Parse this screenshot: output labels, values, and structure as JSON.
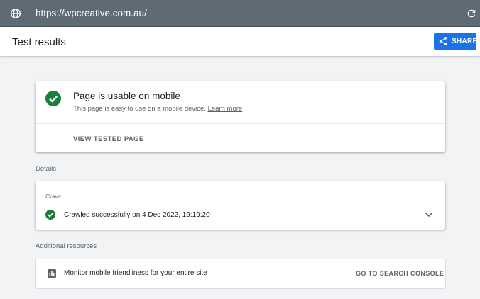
{
  "address_bar": {
    "url": "https://wpcreative.com.au/"
  },
  "header": {
    "title": "Test results",
    "share_label": "SHARE"
  },
  "summary": {
    "headline": "Page is usable on mobile",
    "description": "This page is easy to use on a mobile device.",
    "learn_more": "Learn more",
    "view_button": "VIEW TESTED PAGE"
  },
  "details": {
    "label": "Details",
    "crawl_title": "Crawl",
    "crawl_status": "Crawled successfully on 4 Dec 2022, 19:19:20"
  },
  "resources": {
    "label": "Additional resources",
    "item_text": "Monitor mobile friendliness for your entire site",
    "item_link": "GO TO SEARCH CONSOLE"
  },
  "colors": {
    "accent": "#1a73e8",
    "success": "#188038",
    "topbar": "#5f6b73"
  },
  "icons": [
    "globe-icon",
    "reload-icon",
    "share-icon",
    "check-circle-icon",
    "chevron-down-icon",
    "chart-icon"
  ]
}
